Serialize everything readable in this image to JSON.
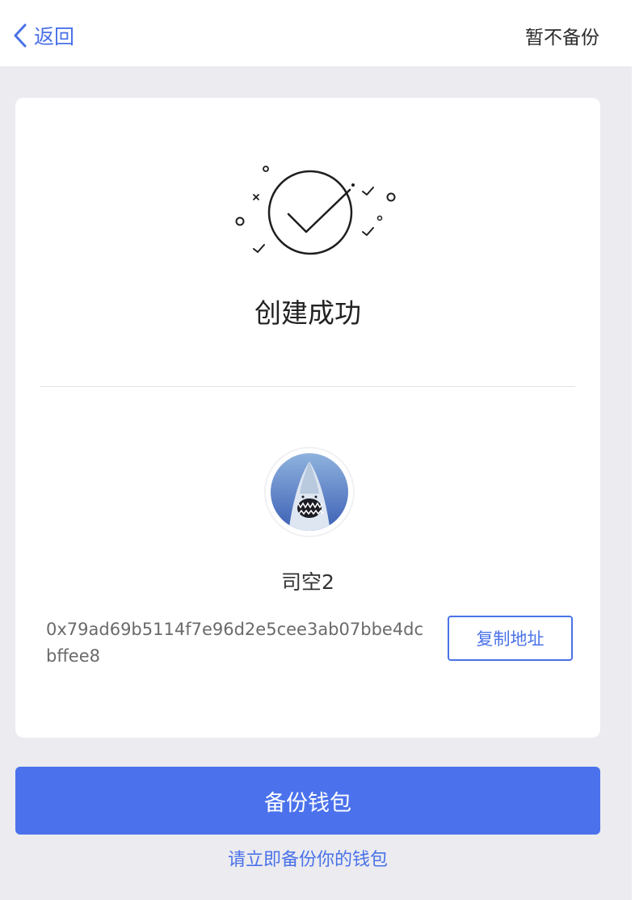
{
  "nav": {
    "back_label": "返回",
    "skip_label": "暂不备份"
  },
  "card": {
    "title": "创建成功",
    "wallet_name": "司空2",
    "address": "0x79ad69b5114f7e96d2e5cee3ab07bbe4dcbffee8",
    "copy_label": "复制地址"
  },
  "actions": {
    "backup_label": "备份钱包",
    "hint": "请立即备份你的钱包"
  },
  "colors": {
    "accent": "#4a72e8",
    "primary_button": "#4b72ec",
    "background": "#ebebf0"
  },
  "icons": {
    "back": "chevron-left-icon",
    "success": "check-circle-icon",
    "avatar": "shark-avatar"
  }
}
